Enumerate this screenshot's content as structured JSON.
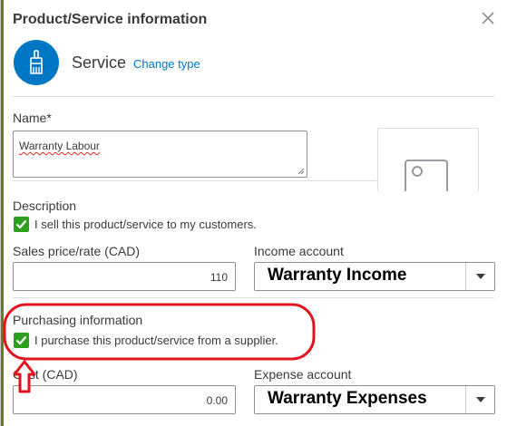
{
  "dialog": {
    "title": "Product/Service information"
  },
  "type": {
    "name": "Service",
    "change_link": "Change type",
    "icon": "paint-brush-icon"
  },
  "name_field": {
    "label": "Name*",
    "value": "Warranty Labour"
  },
  "description": {
    "label": "Description",
    "sell_checkbox_label": "I sell this product/service to my customers.",
    "sell_checked": true
  },
  "sales": {
    "price_label": "Sales price/rate (CAD)",
    "price_value": "110",
    "income_label": "Income account",
    "income_value": "Warranty Income"
  },
  "purchasing": {
    "label": "Purchasing information",
    "purchase_checkbox_label": "I purchase this product/service from a supplier.",
    "purchase_checked": true
  },
  "cost": {
    "cost_label": "Cost (CAD)",
    "cost_value": "0.00",
    "expense_label": "Expense account",
    "expense_value": "Warranty Expenses"
  },
  "colors": {
    "accent_blue": "#0077c5",
    "check_green": "#2ca01c",
    "annotation_red": "#e1141e"
  }
}
